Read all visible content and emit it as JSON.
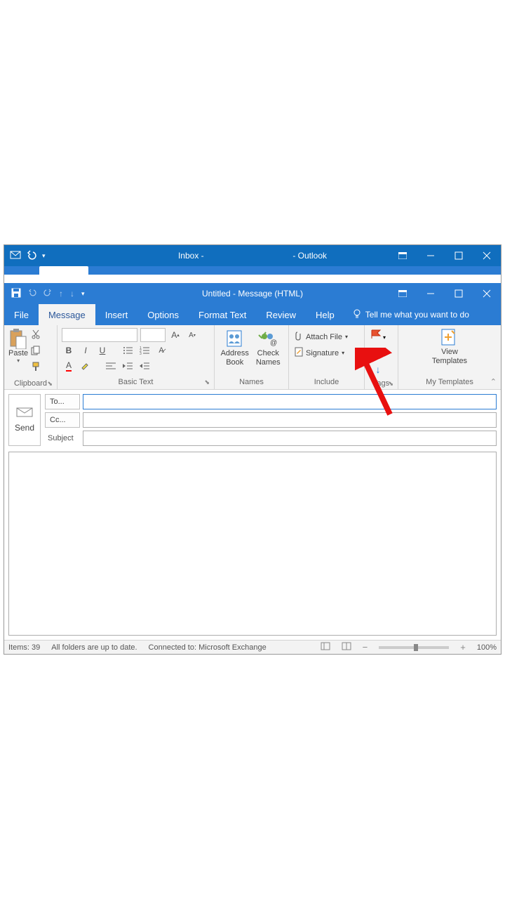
{
  "parent_window": {
    "title_left": "Inbox -",
    "title_right": "- Outlook"
  },
  "child_window": {
    "title": "Untitled  -  Message (HTML)"
  },
  "tabs": {
    "file": "File",
    "message": "Message",
    "insert": "Insert",
    "options": "Options",
    "format_text": "Format Text",
    "review": "Review",
    "help": "Help",
    "tell_me": "Tell me what you want to do"
  },
  "ribbon": {
    "clipboard": {
      "paste": "Paste",
      "group": "Clipboard"
    },
    "basictext": {
      "group": "Basic Text"
    },
    "names": {
      "address_book": "Address Book",
      "check_names": "Check Names",
      "group": "Names"
    },
    "include": {
      "attach_file": "Attach File",
      "signature": "Signature",
      "group": "Include"
    },
    "tags": {
      "group": "Tags"
    },
    "templates": {
      "view_templates": "View Templates",
      "group": "My Templates"
    }
  },
  "compose": {
    "send": "Send",
    "to": "To...",
    "cc": "Cc...",
    "subject": "Subject"
  },
  "statusbar": {
    "items": "Items: 39",
    "folders": "All folders are up to date.",
    "connected": "Connected to: Microsoft Exchange",
    "zoom": "100%"
  }
}
